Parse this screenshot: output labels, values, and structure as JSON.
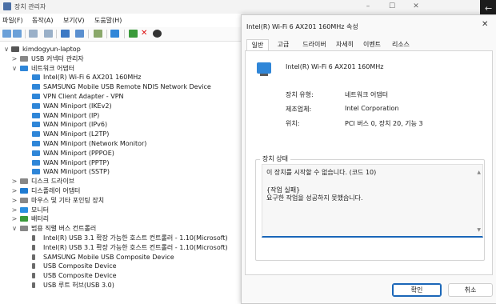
{
  "device_manager": {
    "title": "장치 관리자",
    "menu": [
      "파일(F)",
      "동작(A)",
      "보기(V)",
      "도움말(H)"
    ],
    "tree": [
      {
        "label": "kimdogyun-laptop",
        "level": 0,
        "expander": "∨",
        "icon": "laptop-icon"
      },
      {
        "label": "USB 커넥터 관리자",
        "level": 1,
        "expander": ">",
        "icon": "usb-connector-icon"
      },
      {
        "label": "네트워크 어댑터",
        "level": 1,
        "expander": "∨",
        "icon": "network-adapter-icon"
      },
      {
        "label": "Intel(R) Wi-Fi 6 AX201 160MHz",
        "level": 2,
        "icon": "network-warning-icon"
      },
      {
        "label": "SAMSUNG Mobile USB Remote NDIS Network Device",
        "level": 2,
        "icon": "network-adapter-icon"
      },
      {
        "label": "VPN Client Adapter - VPN",
        "level": 2,
        "icon": "network-adapter-icon"
      },
      {
        "label": "WAN Miniport (IKEv2)",
        "level": 2,
        "icon": "network-adapter-icon"
      },
      {
        "label": "WAN Miniport (IP)",
        "level": 2,
        "icon": "network-adapter-icon"
      },
      {
        "label": "WAN Miniport (IPv6)",
        "level": 2,
        "icon": "network-adapter-icon"
      },
      {
        "label": "WAN Miniport (L2TP)",
        "level": 2,
        "icon": "network-adapter-icon"
      },
      {
        "label": "WAN Miniport (Network Monitor)",
        "level": 2,
        "icon": "network-adapter-icon"
      },
      {
        "label": "WAN Miniport (PPPOE)",
        "level": 2,
        "icon": "network-adapter-icon"
      },
      {
        "label": "WAN Miniport (PPTP)",
        "level": 2,
        "icon": "network-adapter-icon"
      },
      {
        "label": "WAN Miniport (SSTP)",
        "level": 2,
        "icon": "network-adapter-icon"
      },
      {
        "label": "디스크 드라이브",
        "level": 1,
        "expander": ">",
        "icon": "disk-drive-icon"
      },
      {
        "label": "디스플레이 어댑터",
        "level": 1,
        "expander": ">",
        "icon": "display-adapter-icon"
      },
      {
        "label": "마우스 및 기타 포인팅 장치",
        "level": 1,
        "expander": ">",
        "icon": "mouse-icon"
      },
      {
        "label": "모니터",
        "level": 1,
        "expander": ">",
        "icon": "monitor-icon"
      },
      {
        "label": "배터리",
        "level": 1,
        "expander": ">",
        "icon": "battery-icon"
      },
      {
        "label": "범용 직렬 버스 컨트롤러",
        "level": 1,
        "expander": "∨",
        "icon": "usb-controller-icon"
      },
      {
        "label": "Intel(R) USB 3.1 확장 가능한 호스트 컨트롤러 - 1.10(Microsoft)",
        "level": 2,
        "icon": "usb-device-icon"
      },
      {
        "label": "Intel(R) USB 3.1 확장 가능한 호스트 컨트롤러 - 1.10(Microsoft)",
        "level": 2,
        "icon": "usb-device-icon"
      },
      {
        "label": "SAMSUNG Mobile USB Composite Device",
        "level": 2,
        "icon": "usb-device-icon"
      },
      {
        "label": "USB Composite Device",
        "level": 2,
        "icon": "usb-device-icon"
      },
      {
        "label": "USB Composite Device",
        "level": 2,
        "icon": "usb-device-icon"
      },
      {
        "label": "USB 루트 허브(USB 3.0)",
        "level": 2,
        "icon": "usb-device-icon"
      }
    ]
  },
  "dialog": {
    "title": "Intel(R) Wi-Fi 6 AX201 160MHz 속성",
    "tabs": [
      "일반",
      "고급",
      "드라이버",
      "자세히",
      "이벤트",
      "리소스"
    ],
    "active_tab": "일반",
    "device_name": "Intel(R) Wi-Fi 6 AX201 160MHz",
    "props": [
      {
        "key": "장치 유형:",
        "value": "네트워크 어댑터"
      },
      {
        "key": "제조업체:",
        "value": "Intel Corporation"
      },
      {
        "key": "위치:",
        "value": "PCI 버스 0, 장치 20, 기능 3"
      }
    ],
    "status_group_label": "장치 상태",
    "status_lines": [
      "이 장치를 시작할 수 없습니다. (코드 10)",
      "",
      "{작업 실패}",
      "요구한 작업을 성공하지 못했습니다."
    ],
    "ok_label": "확인",
    "cancel_label": "취소"
  },
  "colors": {
    "accent": "#1a66b8",
    "network_icon": "#2f86d8"
  }
}
